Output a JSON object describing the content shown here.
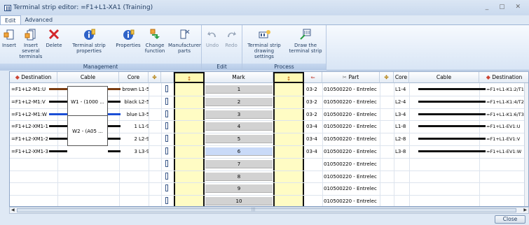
{
  "window": {
    "title": "Terminal strip editor: =F1+L1-XA1 (Training)",
    "controls": "_ ▢ ✕"
  },
  "tabs": [
    {
      "label": "Edit",
      "active": true
    },
    {
      "label": "Advanced",
      "active": false
    }
  ],
  "ribbon": {
    "groups": [
      {
        "label": "Management",
        "buttons": [
          {
            "label": "Insert",
            "icon": "insert-terminal-icon"
          },
          {
            "label": "Insert several terminals",
            "icon": "insert-several-icon"
          },
          {
            "label": "Delete",
            "icon": "delete-icon"
          },
          {
            "label": "Terminal strip properties",
            "icon": "strip-properties-icon"
          },
          {
            "label": "Properties",
            "icon": "properties-icon"
          },
          {
            "label": "Change function",
            "icon": "change-function-icon"
          },
          {
            "label": "Manufacturer parts",
            "icon": "manufacturer-parts-icon"
          }
        ]
      },
      {
        "label": "Edit",
        "buttons": [
          {
            "label": "Undo",
            "icon": "undo-icon",
            "disabled": true
          },
          {
            "label": "Redo",
            "icon": "redo-icon",
            "disabled": true
          }
        ]
      },
      {
        "label": "Process",
        "buttons": [
          {
            "label": "Terminal strip drawing settings",
            "icon": "drawing-settings-icon"
          },
          {
            "label": "Draw the terminal strip",
            "icon": "draw-strip-icon"
          }
        ]
      }
    ]
  },
  "grid": {
    "headers": {
      "destination_left": "Destination",
      "cable_left": "Cable",
      "core_left": "Core",
      "mark": "Mark",
      "part": "Part",
      "core_right": "Core",
      "cable_right": "Cable",
      "destination_right": "Destination"
    },
    "rows": [
      {
        "dest_l": "=F1+L2-M1:U",
        "core_color": "brown",
        "core_l": "L1-5",
        "mark": "1",
        "conn": "03-2",
        "part": "010500220 - Entrelec",
        "core_r": "L1-4",
        "dest_r": "=F1+L1-K1:2/T1"
      },
      {
        "dest_l": "=F1+L2-M1:V",
        "core_color": "black",
        "core_l": "L2-5",
        "mark": "2",
        "conn": "03-2",
        "part": "010500220 - Entrelec",
        "core_r": "L2-4",
        "dest_r": "=F1+L1-K1:4/T2"
      },
      {
        "dest_l": "=F1+L2-M1:W",
        "core_color": "blue",
        "core_l": "L3-5",
        "mark": "3",
        "conn": "03-2",
        "part": "010500220 - Entrelec",
        "core_r": "L3-4",
        "dest_r": "=F1+L1-K1:6/T3"
      },
      {
        "dest_l": "=F1+L2-XM1-1",
        "core_color": "1",
        "core_l": "L1-9",
        "mark": "4",
        "conn": "03-4",
        "part": "010500220 - Entrelec",
        "core_r": "L1-8",
        "dest_r": "=F1+L1-EV1:U"
      },
      {
        "dest_l": "=F1+L2-XM1-2",
        "core_color": "2",
        "core_l": "L2-9",
        "mark": "5",
        "conn": "03-4",
        "part": "010500220 - Entrelec",
        "core_r": "L2-8",
        "dest_r": "=F1+L1-EV1:V"
      },
      {
        "dest_l": "=F1+L2-XM1-3",
        "core_color": "3",
        "core_l": "L3-9",
        "mark": "6",
        "conn": "03-4",
        "part": "010500220 - Entrelec",
        "core_r": "L3-8",
        "dest_r": "=F1+L1-EV1:W"
      },
      {
        "dest_l": "",
        "core_color": "",
        "core_l": "",
        "mark": "7",
        "conn": "",
        "part": "010500220 - Entrelec",
        "core_r": "",
        "dest_r": ""
      },
      {
        "dest_l": "",
        "core_color": "",
        "core_l": "",
        "mark": "8",
        "conn": "",
        "part": "010500220 - Entrelec",
        "core_r": "",
        "dest_r": ""
      },
      {
        "dest_l": "",
        "core_color": "",
        "core_l": "",
        "mark": "9",
        "conn": "",
        "part": "010500220 - Entrelec",
        "core_r": "",
        "dest_r": ""
      },
      {
        "dest_l": "",
        "core_color": "",
        "core_l": "",
        "mark": "10",
        "conn": "",
        "part": "010500220 - Entrelec",
        "core_r": "",
        "dest_r": ""
      }
    ],
    "cables": [
      {
        "label": "W1 - (1000 ..."
      },
      {
        "label": "W2 - (A05 ..."
      }
    ],
    "selected_mark_row": 6
  },
  "footer": {
    "close_label": "Close"
  },
  "colors": {
    "accent": "#1e3a5f",
    "highlight_yellow": "#fffcc4",
    "selected_row": "#c9daf8",
    "mark_row": "#d2d2d2"
  }
}
